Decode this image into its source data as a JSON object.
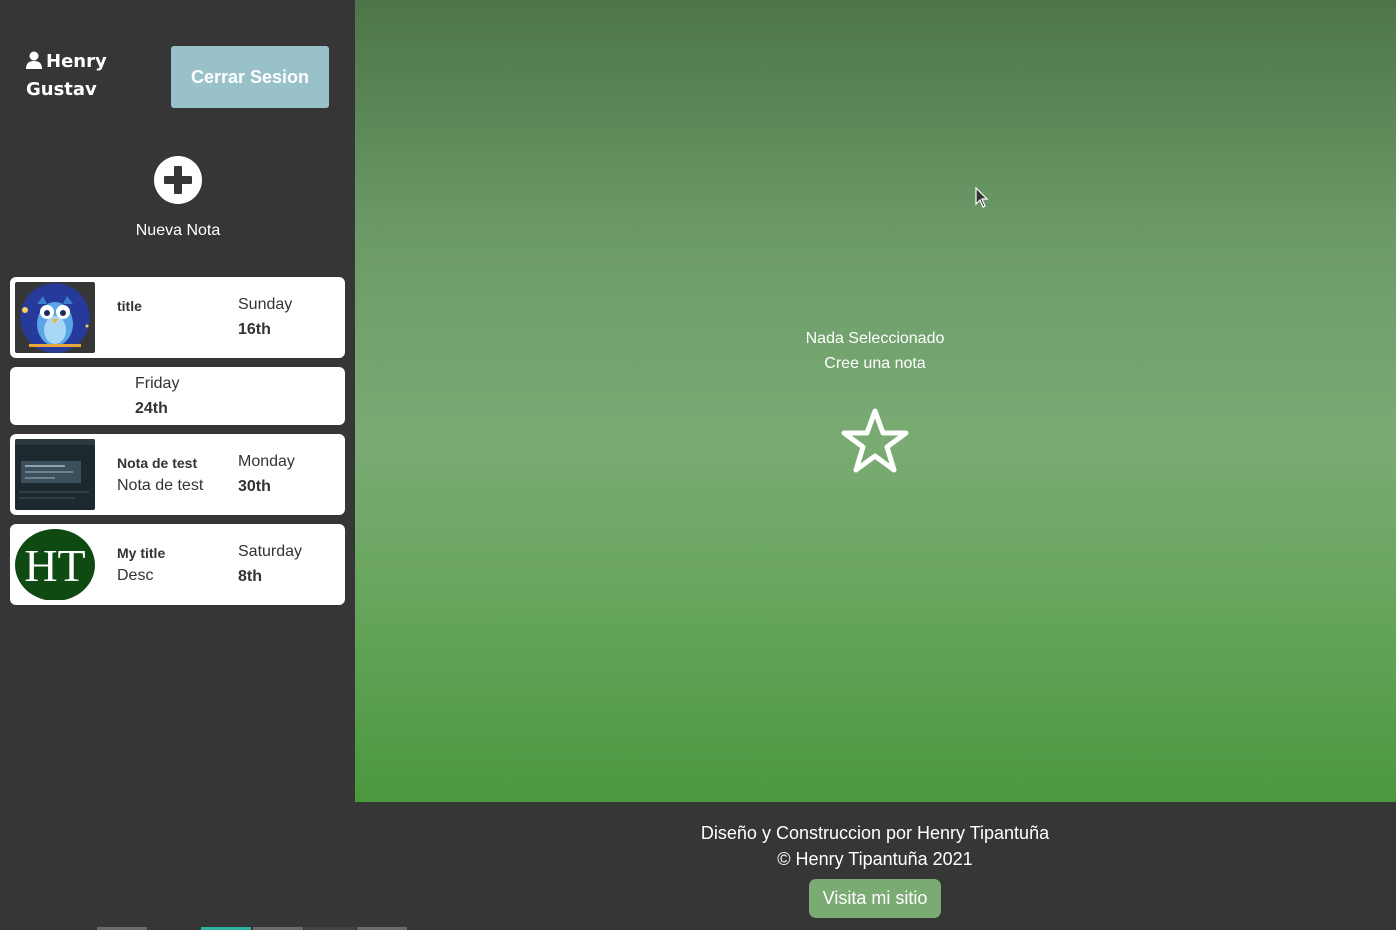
{
  "user": {
    "name_line1": "Henry",
    "name_line2": "Gustav"
  },
  "sidebar": {
    "logout_label": "Cerrar Sesion",
    "new_note_label": "Nueva Nota",
    "entries": [
      {
        "title": "title",
        "desc": "",
        "day": "Sunday",
        "date": "16th",
        "thumb": "owl"
      },
      {
        "title": "",
        "desc": "",
        "day": "Friday",
        "date": "24th",
        "thumb": ""
      },
      {
        "title": "Nota de test",
        "desc": "Nota de test",
        "day": "Monday",
        "date": "30th",
        "thumb": "screenshot"
      },
      {
        "title": "My title",
        "desc": "Desc",
        "day": "Saturday",
        "date": "8th",
        "thumb": "HT"
      }
    ]
  },
  "main": {
    "nothing_line1": "Nada Seleccionado",
    "nothing_line2": "Cree una nota",
    "icon": "star-outline-icon"
  },
  "footer": {
    "line1": "Diseño y Construccion por Henry Tipantuña",
    "line2": "© Henry Tipantuña 2021",
    "visit_label": "Visita mi sitio"
  },
  "colors": {
    "sidebar_bg": "#363636",
    "logout_bg": "#98c1c9",
    "visit_bg": "#7aab73",
    "main_top": "#4d7549",
    "main_bottom": "#4a983e"
  }
}
